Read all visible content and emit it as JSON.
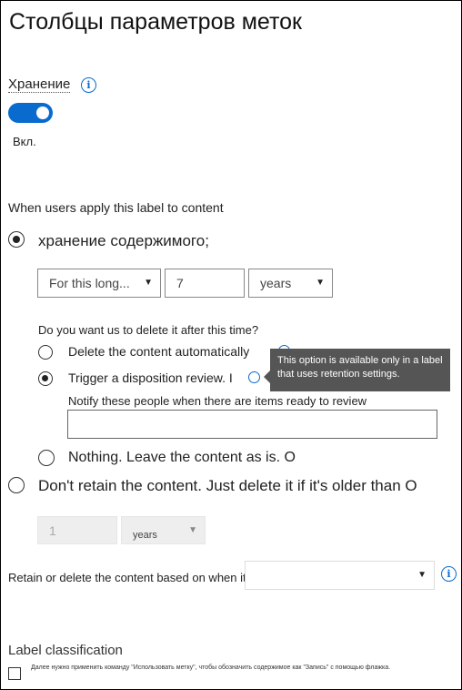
{
  "page": {
    "title": "Столбцы параметров меток"
  },
  "retention": {
    "label": "Хранение",
    "toggle_on": true,
    "toggle_state": "Вкл."
  },
  "apply_section": {
    "label": "When users apply this label to content"
  },
  "retain_option": {
    "label": "хранение содержимого;",
    "selected": true,
    "period_select": "For this long...",
    "period_value": "7",
    "unit_select": "years"
  },
  "delete_question": {
    "label": "Do you want us to delete it after this time?",
    "options": [
      {
        "label": "Delete the content automatically",
        "selected": false
      },
      {
        "label": "Trigger a disposition review. I",
        "selected": true
      },
      {
        "label": "Nothing. Leave the content as is. O",
        "selected": false
      }
    ],
    "notify_label": "Notify these people when there are items ready to review",
    "notify_value": ""
  },
  "tooltip": {
    "text": "This option is available only in a label that uses retention settings."
  },
  "dont_retain_option": {
    "label": "Don't retain the content. Just delete it if it's older than O",
    "selected": false,
    "value": "1",
    "unit": "years"
  },
  "based_on": {
    "label": "Retain or delete the content based on when it was created",
    "select_value": ""
  },
  "classification": {
    "title": "Label classification",
    "checkbox_label": "Далее нужно применить команду \"Использовать метку\", чтобы обозначить содержимое как \"Запись\" с помощью флажка.",
    "checked": false
  },
  "colors": {
    "accent": "#0a6bcf",
    "tooltip_bg": "#555555"
  }
}
